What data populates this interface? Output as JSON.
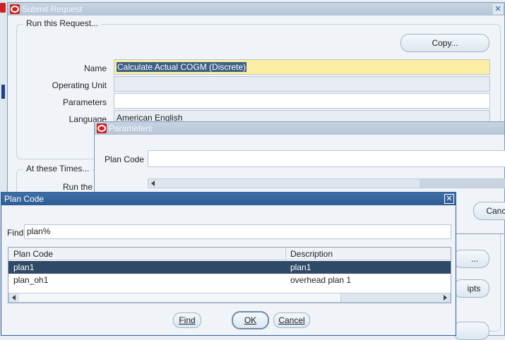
{
  "submit_request": {
    "title": "Submit Request",
    "section_run": "Run this Request...",
    "copy_button": "Copy...",
    "name_label": "Name",
    "name_value": "Calculate Actual COGM (Discrete)",
    "operating_unit_label": "Operating Unit",
    "operating_unit_value": "",
    "parameters_label": "Parameters",
    "parameters_value": "",
    "language_label": "Language",
    "language_value": "American English",
    "section_times": "At these Times...",
    "run_the_label": "Run the",
    "options_button_partial": "...",
    "receipts_button_partial": "ipts"
  },
  "parameters_dialog": {
    "title": "Parameters",
    "plan_code_label": "Plan Code",
    "plan_code_value": "",
    "cancel_button": "Cancel"
  },
  "plan_code_lov": {
    "title": "Plan Code",
    "find_label": "Find",
    "find_value": "plan%",
    "columns": [
      "Plan Code",
      "Description"
    ],
    "rows": [
      {
        "code": "plan1",
        "description": "plan1",
        "selected": true
      },
      {
        "code": "plan_oh1",
        "description": "overhead plan 1",
        "selected": false
      }
    ],
    "find_button": "Find",
    "ok_button": "OK",
    "cancel_button": "Cancel"
  },
  "colors": {
    "active_title": "#2e5d94",
    "inactive_title": "#b6c6d8",
    "name_highlight": "#fceea3",
    "selected_row": "#2f4a66"
  }
}
